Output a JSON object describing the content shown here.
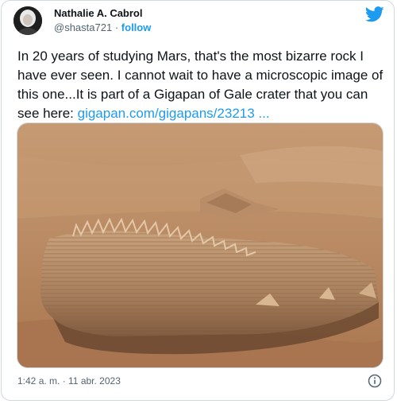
{
  "tweet": {
    "author_name": "Nathalie A. Cabrol",
    "handle": "@shasta721",
    "separator": "·",
    "follow_label": "follow",
    "text_main": "In 20 years of studying Mars, that's the most bizarre rock I have ever seen. I cannot wait to have a microscopic image of this one...It is part of a Gigapan of Gale crater that you can see here: ",
    "link_text": "gigapan.com/gigapans/23213 ...",
    "timestamp": "1:42 a. m. · 11 abr. 2023"
  },
  "icons": {
    "logo": "twitter-bird-icon",
    "info": "info-icon"
  },
  "colors": {
    "accent": "#1d9bf0",
    "text": "#0f1419",
    "muted": "#536471",
    "border": "#cfd9de",
    "mars_sand": "#b98a63"
  }
}
